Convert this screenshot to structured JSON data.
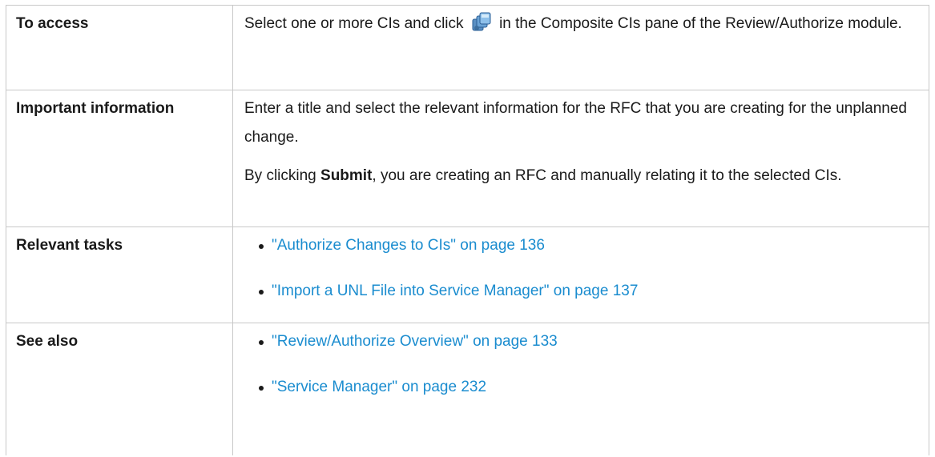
{
  "rows": {
    "access": {
      "label": "To access",
      "text_before_icon": "Select one or more CIs and click",
      "icon": "composite-ci-rfc-icon",
      "text_after_icon": "in the Composite CIs pane of the Review/Authorize module."
    },
    "important": {
      "label": "Important information",
      "paragraph1": "Enter a title and select the relevant information for the RFC that you are creating for the unplanned change.",
      "paragraph2_before": "By clicking ",
      "paragraph2_bold": "Submit",
      "paragraph2_after": ", you are creating an RFC and manually relating it to the selected CIs."
    },
    "tasks": {
      "label": "Relevant tasks",
      "links": [
        "\"Authorize Changes to CIs\" on page 136",
        "\"Import a UNL File into Service Manager\" on page 137"
      ]
    },
    "also": {
      "label": "See also",
      "links": [
        "\"Review/Authorize Overview\" on page 133",
        "\"Service Manager\" on page 232"
      ]
    }
  },
  "colors": {
    "link": "#1a8ccf",
    "border": "#c8c8c8",
    "text": "#1a1a1a"
  }
}
